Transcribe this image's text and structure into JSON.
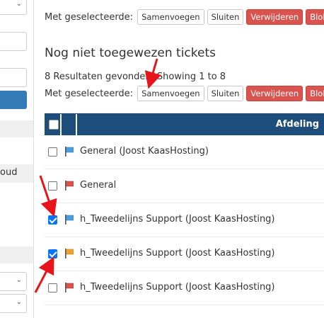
{
  "toolbar_top": {
    "label": "Met geselecteerde:",
    "buttons": [
      "Samenvoegen",
      "Sluiten",
      "Verwijderen",
      "Blokk"
    ]
  },
  "section": {
    "title": "Nog niet toegewezen tickets",
    "results": "8 Resultaten gevonden, Showing 1 to 8"
  },
  "toolbar_bottom": {
    "label": "Met geselecteerde:",
    "buttons": [
      "Samenvoegen",
      "Sluiten",
      "Verwijderen",
      "Blokk"
    ]
  },
  "table": {
    "header": {
      "department": "Afdeling"
    },
    "rows": [
      {
        "label": "General (Joost KaasHosting)",
        "checked": false,
        "flag": "blue"
      },
      {
        "label": "General",
        "checked": false,
        "flag": "red"
      },
      {
        "label": "h_Tweedelijns Support (Joost KaasHosting)",
        "checked": true,
        "flag": "blue"
      },
      {
        "label": "h_Tweedelijns Support (Joost KaasHosting)",
        "checked": true,
        "flag": "orange"
      },
      {
        "label": "h_Tweedelijns Support (Joost KaasHosting)",
        "checked": false,
        "flag": "red"
      }
    ]
  },
  "sidebar": {
    "partial_text": "oud"
  },
  "colors": {
    "header_bg": "#1d4d7b",
    "danger": "#d9534f",
    "primary": "#337ab7",
    "checkbox_checked": "#0075ff",
    "arrow": "#e8141b",
    "flag_blue": "#4a9ee0",
    "flag_red": "#d9534f",
    "flag_orange": "#f0a030"
  },
  "icons": {
    "flag": "flag-icon",
    "annotation": "red-arrow-annotation",
    "chevron": "chevron-down-icon"
  }
}
